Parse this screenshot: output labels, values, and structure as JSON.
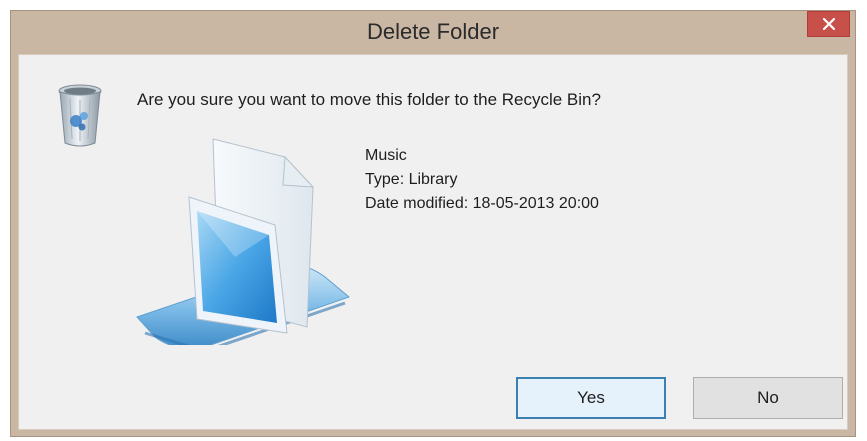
{
  "window": {
    "title": "Delete Folder",
    "close_label": "×"
  },
  "message": {
    "question": "Are you sure you want to move this folder to the Recycle Bin?"
  },
  "item": {
    "name": "Music",
    "type": "Type: Library",
    "date_modified": "Date modified: 18-05-2013 20:00",
    "icon": "library-icon"
  },
  "buttons": {
    "yes_label": "Yes",
    "no_label": "No"
  },
  "colors": {
    "title_bar": "#c9b7a4",
    "close_button": "#c7504a",
    "client_background": "#f0f0f0",
    "default_button_border": "#3c7fb1"
  }
}
